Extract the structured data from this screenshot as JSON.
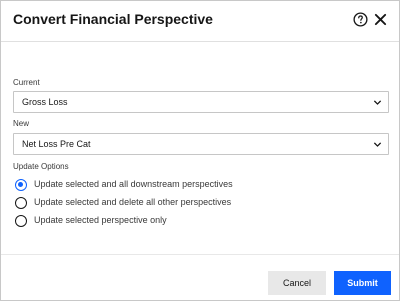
{
  "dialog": {
    "title": "Convert Financial Perspective",
    "help_icon": "help-circle-icon",
    "close_icon": "close-x-icon"
  },
  "current": {
    "label": "Current",
    "value": "Gross Loss"
  },
  "new": {
    "label": "New",
    "value": "Net Loss Pre Cat"
  },
  "update_options": {
    "label": "Update Options",
    "options": [
      {
        "label": "Update selected and all downstream perspectives",
        "selected": true
      },
      {
        "label": "Update selected and delete all other perspectives",
        "selected": false
      },
      {
        "label": "Update selected perspective only",
        "selected": false
      }
    ]
  },
  "footer": {
    "cancel_label": "Cancel",
    "submit_label": "Submit"
  },
  "colors": {
    "accent": "#0f62fe",
    "text": "#161616"
  }
}
